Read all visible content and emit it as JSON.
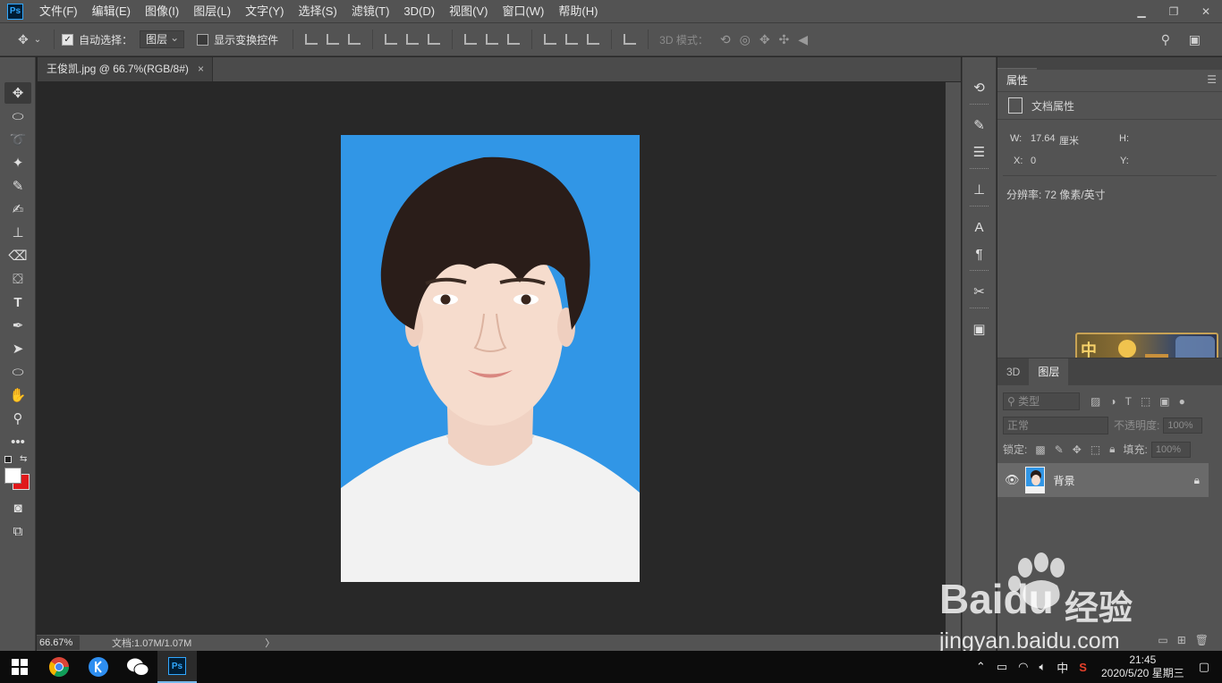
{
  "app": {
    "logo": "Ps"
  },
  "menu": [
    "文件(F)",
    "编辑(E)",
    "图像(I)",
    "图层(L)",
    "文字(Y)",
    "选择(S)",
    "滤镜(T)",
    "3D(D)",
    "视图(V)",
    "窗口(W)",
    "帮助(H)"
  ],
  "options": {
    "auto_select_label": "自动选择：",
    "auto_select_checked": true,
    "auto_select_target": "图层",
    "show_transform_label": "显示变换控件",
    "show_transform_checked": false,
    "mode3d_label": "3D 模式："
  },
  "document": {
    "tab_title": "王俊凯.jpg @ 66.7%(RGB/8#)",
    "close_glyph": "×"
  },
  "status": {
    "zoom": "66.67%",
    "doc_size": "文档:1.07M/1.07M",
    "arrow": "〉"
  },
  "properties": {
    "tab": "属性",
    "header": "文档属性",
    "w_label": "W:",
    "w_value": "17.64",
    "w_unit": "厘米",
    "h_label": "H:",
    "x_label": "X:",
    "x_value": "0",
    "y_label": "Y:",
    "resolution": "分辨率: 72 像素/英寸"
  },
  "overlay": {
    "char": "中"
  },
  "layers": {
    "tabs": [
      "3D",
      "图层"
    ],
    "active_tab": "图层",
    "filter_label": "类型",
    "blend_mode": "正常",
    "opacity_label": "不透明度:",
    "opacity_value": "100%",
    "lock_label": "锁定:",
    "fill_label": "填充:",
    "fill_value": "100%",
    "items": [
      {
        "name": "背景",
        "visible": true,
        "locked": true
      }
    ]
  },
  "watermark": {
    "brand": "Baidu",
    "brand_cn": "经验",
    "url": "jingyan.baidu.com"
  },
  "taskbar": {
    "ime": "中",
    "time": "21:45",
    "date": "2020/5/20 星期三"
  },
  "colors": {
    "photo_bg": "#3196e6",
    "foreground": "#ffffff",
    "background": "#e0191b",
    "accent": "#31a8ff"
  }
}
